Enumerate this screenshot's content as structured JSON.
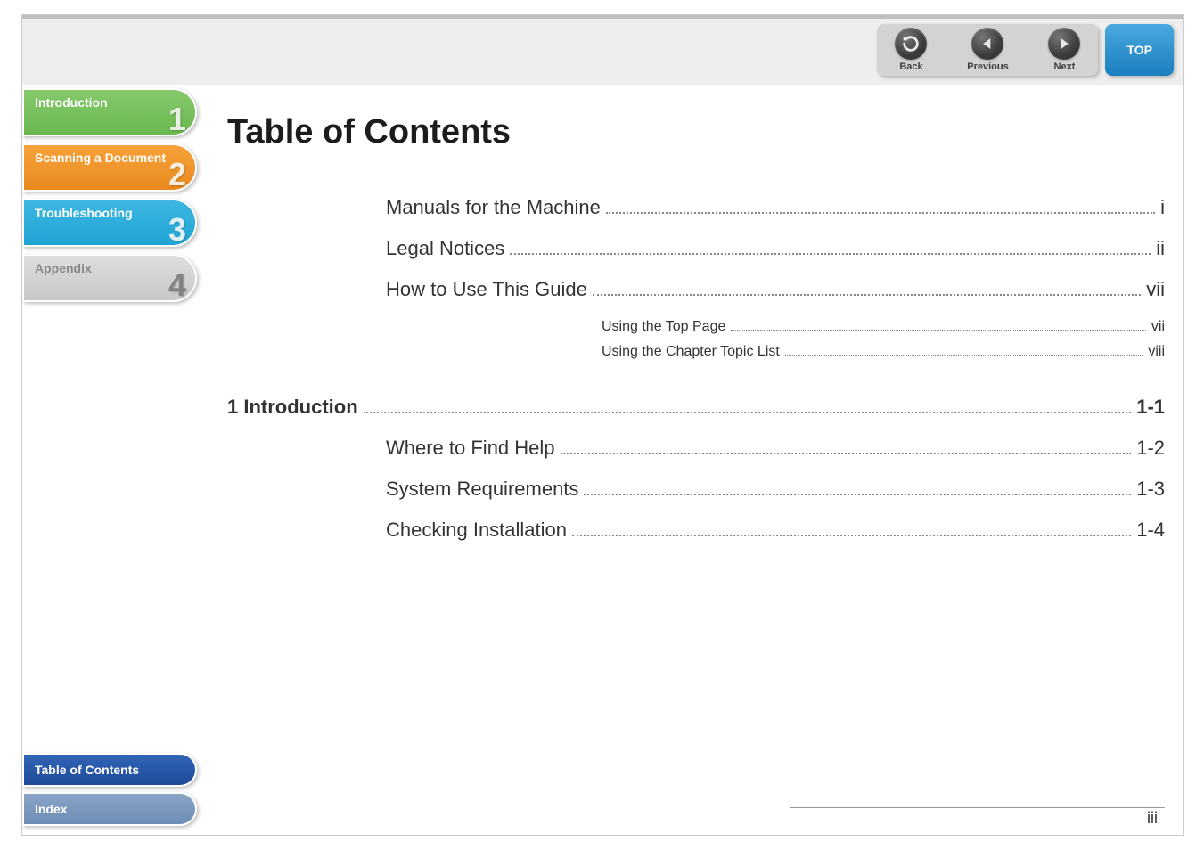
{
  "nav": {
    "back": "Back",
    "previous": "Previous",
    "next": "Next",
    "top": "TOP"
  },
  "tabs": [
    {
      "label": "Introduction",
      "num": "1"
    },
    {
      "label": "Scanning a Document",
      "num": "2"
    },
    {
      "label": "Troubleshooting",
      "num": "3"
    },
    {
      "label": "Appendix",
      "num": "4"
    }
  ],
  "bottom_tabs": {
    "toc": "Table of Contents",
    "index": "Index"
  },
  "title": "Table of Contents",
  "toc": {
    "r0": {
      "label": "Manuals for the Machine",
      "page": "i"
    },
    "r1": {
      "label": "Legal Notices",
      "page": "ii"
    },
    "r2": {
      "label": "How to Use This Guide",
      "page": "vii"
    },
    "r2a": {
      "label": "Using the Top Page",
      "page": "vii"
    },
    "r2b": {
      "label": "Using the Chapter Topic List",
      "page": "viii"
    },
    "ch1": {
      "label": "1 Introduction",
      "page": "1-1"
    },
    "r3": {
      "label": "Where to Find Help",
      "page": "1-2"
    },
    "r4": {
      "label": "System Requirements",
      "page": "1-3"
    },
    "r5": {
      "label": "Checking Installation",
      "page": "1-4"
    }
  },
  "page_number": "iii"
}
